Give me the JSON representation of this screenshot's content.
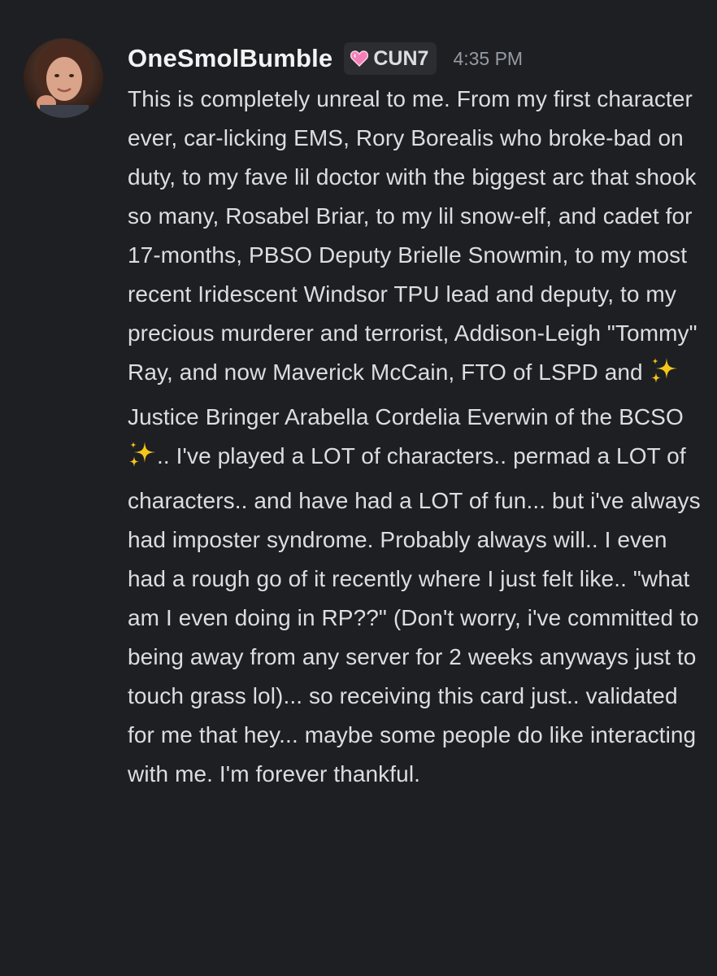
{
  "message": {
    "author": {
      "name": "OneSmolBumble",
      "avatar": "user-avatar-photo"
    },
    "tag": {
      "icon": "pink-heart-icon",
      "text": "CUN7",
      "color": "#f47fb6"
    },
    "timestamp": "4:35 PM",
    "text_parts": {
      "p1": "This is completely unreal to me. From my first character ever, car-licking EMS, Rory Borealis who broke-bad on duty, to my fave lil doctor with the biggest arc that shook so many, Rosabel Briar, to my lil snow-elf, and cadet for 17-months, PBSO Deputy Brielle Snowmin, to my most recent Iridescent Windsor TPU lead and deputy, to my precious murderer and terrorist, Addison-Leigh \"Tommy\" Ray, and now Maverick McCain, FTO of LSPD and ",
      "p2": " Justice Bringer Arabella Cordelia Everwin of the BCSO ",
      "p3": ".. I've played a LOT of characters.. permad a LOT of characters.. and have had a LOT of fun... but i've always had imposter syndrome. Probably always will.. I even had a rough go of it recently where I just felt like.. \"what am I even doing in RP??\" (Don't worry, i've committed to being away from any server for 2 weeks anyways just to touch grass lol)... so receiving this card just.. validated for me that hey... maybe some people do like interacting with me. I'm forever thankful."
    },
    "emoji": "sparkles-emoji",
    "colors": {
      "background": "#1e1f22",
      "text": "#dbdee1",
      "username": "#f2f3f5",
      "timestamp": "#949ba4",
      "sparkle": "#f5c518"
    }
  }
}
